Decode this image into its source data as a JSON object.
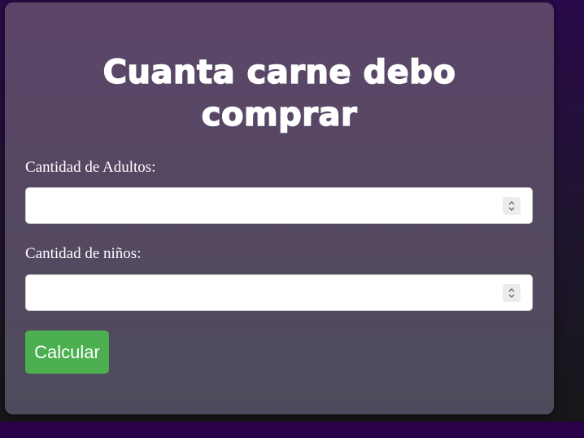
{
  "form": {
    "title_line1": "Cuanta carne debo",
    "title_line2": "comprar",
    "adults_label": "Cantidad de Adultos:",
    "adults_value": "",
    "kids_label": "Cantidad de niños:",
    "kids_value": "",
    "submit_label": "Calcular"
  },
  "icons": {
    "spinner": "chevron-up-down-icon"
  },
  "colors": {
    "button": "#4caf50",
    "card_top": "#5c4568",
    "card_bottom": "#4e4c5c",
    "background_top": "#2a0a4a"
  }
}
